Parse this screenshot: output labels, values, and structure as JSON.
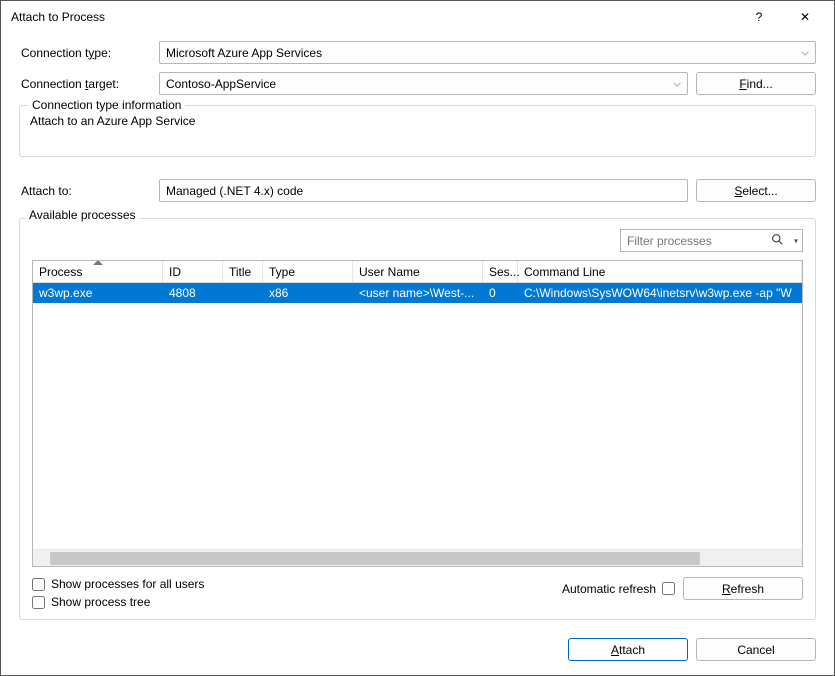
{
  "window": {
    "title": "Attach to Process",
    "help_icon": "?",
    "close_icon": "✕"
  },
  "connection": {
    "type_label_pre": "Connection t",
    "type_label_u": "y",
    "type_label_post": "pe:",
    "type_value": "Microsoft Azure App Services",
    "target_label_pre": "Connection ",
    "target_label_u": "t",
    "target_label_post": "arget:",
    "target_value": "Contoso-AppService",
    "find_pre": "",
    "find_u": "F",
    "find_post": "ind..."
  },
  "info": {
    "legend": "Connection type information",
    "text": "Attach to an Azure App Service"
  },
  "attach": {
    "label": "Attach to:",
    "value": "Managed (.NET 4.x) code",
    "select_pre": "",
    "select_u": "S",
    "select_post": "elect..."
  },
  "processes": {
    "label_u": "A",
    "label_post": "vailable processes",
    "filter_placeholder": "Filter processes",
    "columns": {
      "process": "Process",
      "id": "ID",
      "title": "Title",
      "type": "Type",
      "user": "User Name",
      "session": "Ses...",
      "cmd": "Command Line"
    },
    "rows": [
      {
        "process": "w3wp.exe",
        "id": "4808",
        "title": "",
        "type": "x86",
        "user": "<user name>\\West-...",
        "session": "0",
        "cmd": "C:\\Windows\\SysWOW64\\inetsrv\\w3wp.exe -ap \"W"
      }
    ]
  },
  "checks": {
    "all_users_pre": "Show processes for all ",
    "all_users_u": "u",
    "all_users_post": "sers",
    "tree_pre": "Show process t",
    "tree_u": "r",
    "tree_post": "ee",
    "auto_refresh": "Automatic refresh",
    "refresh_u": "R",
    "refresh_post": "efresh"
  },
  "footer": {
    "attach_u": "A",
    "attach_post": "ttach",
    "cancel": "Cancel"
  }
}
